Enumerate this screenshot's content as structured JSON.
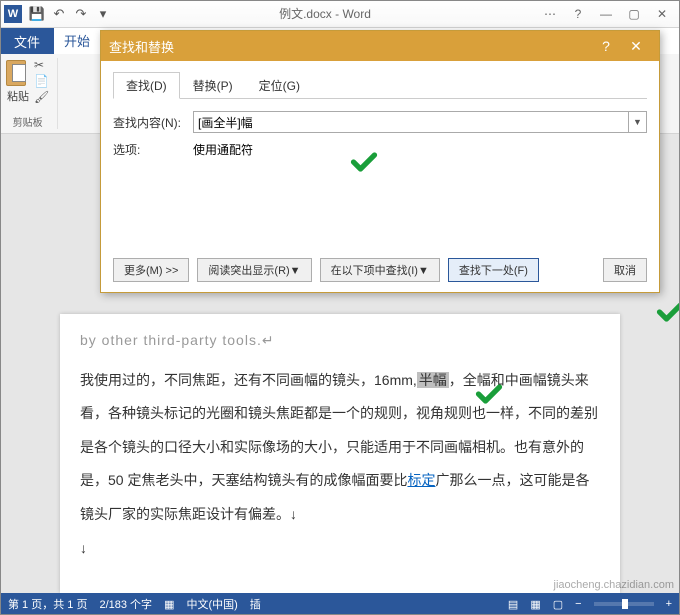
{
  "titlebar": {
    "word_badge": "W",
    "doc_title": "例文.docx - Word",
    "qat": {
      "save": "💾",
      "undo": "↶",
      "redo": "↷",
      "more": "▾"
    },
    "window": {
      "help": "?",
      "min": "—",
      "max": "▢",
      "close": "✕",
      "ribbon_opts": "⋯"
    }
  },
  "ribbon": {
    "file_tab": "文件",
    "home_tab": "开始",
    "paste_label": "粘贴",
    "clipboard_group": "剪贴板",
    "cut_icon": "✂",
    "copy_icon": "📄",
    "fmt_icon": "🖌"
  },
  "dialog": {
    "title": "查找和替换",
    "help": "?",
    "close": "✕",
    "tabs": {
      "find": "查找(D)",
      "replace": "替换(P)",
      "goto": "定位(G)"
    },
    "find_label": "查找内容(N):",
    "find_value": "[画全半]幅",
    "options_label": "选项:",
    "options_value": "使用通配符",
    "buttons": {
      "more": "更多(M) >>",
      "highlight": "阅读突出显示(R)▼",
      "find_in": "在以下项中查找(I)▼",
      "find_next": "查找下一处(F)",
      "cancel": "取消"
    }
  },
  "document": {
    "english_remnant": "by other third-party tools.↵",
    "body1_a": "我使用过的，不同焦距，还有不同画幅的镜头，16mm,",
    "body1_hl": "半幅",
    "body1_b": "，全幅和中画幅镜头来看，各种镜头标记的光圈和镜头焦距都是一个的规则，视角规则也一样，不同的差别是各个镜头的口径大小和实际像场的大小，只能适用于不同画幅相机。也有意外的是，50 定焦老头中，天塞结构镜头有的成像幅面要比",
    "body1_link": "标定",
    "body1_c": "广那么一点，这可能是各镜头厂家的实际焦距设计有偏差。↓",
    "arrow": "↓"
  },
  "statusbar": {
    "page": "第 1 页，共 1 页",
    "words": "2/183 个字",
    "lang_icon": "▦",
    "lang": "中文(中国)",
    "insert": "插",
    "views": {
      "read": "▤",
      "print": "▦",
      "web": "▢"
    },
    "zoom_out": "−",
    "zoom_in": "+"
  },
  "watermark": "jiaocheng.chazidian.com"
}
